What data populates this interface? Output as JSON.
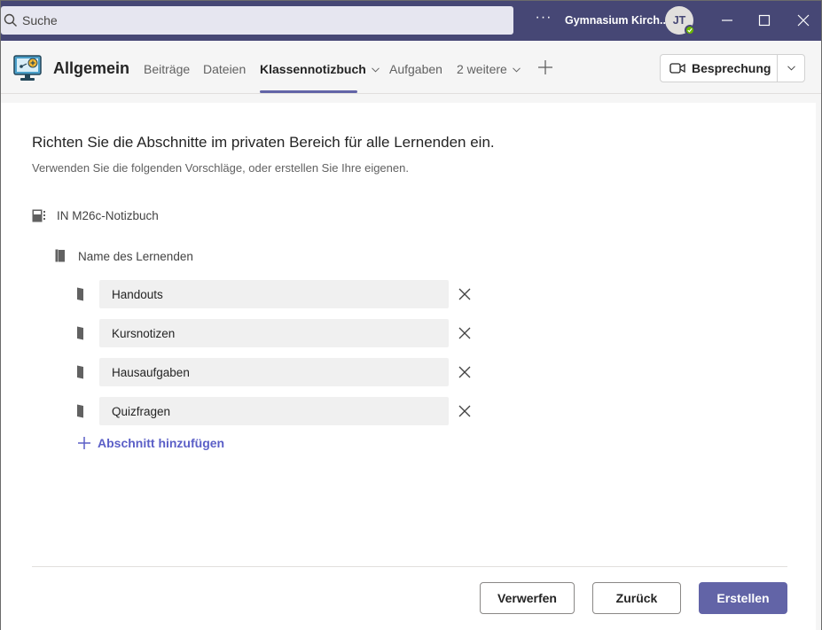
{
  "titlebar": {
    "search_placeholder": "Suche",
    "more_label": "···",
    "org_name": "Gymnasium Kirch...",
    "avatar_initials": "JT",
    "accent": "#464775"
  },
  "channel": {
    "title": "Allgemein",
    "tabs": [
      {
        "label": "Beiträge"
      },
      {
        "label": "Dateien"
      },
      {
        "label": "Klassennotizbuch"
      },
      {
        "label": "Aufgaben"
      },
      {
        "label": "2 weitere"
      }
    ],
    "active_tab": "Klassennotizbuch",
    "meeting_button": "Besprechung"
  },
  "dialog": {
    "headline": "Richten Sie die Abschnitte im privaten Bereich für alle Lernenden ein.",
    "subline": "Verwenden Sie die folgenden Vorschläge, oder erstellen Sie Ihre eigenen.",
    "notebook_name": "IN M26c-Notizbuch",
    "section_group": "Name des Lernenden",
    "sections": [
      {
        "name": "Handouts"
      },
      {
        "name": "Kursnotizen"
      },
      {
        "name": "Hausaufgaben"
      },
      {
        "name": "Quizfragen"
      }
    ],
    "add_section": "Abschnitt hinzufügen",
    "buttons": {
      "discard": "Verwerfen",
      "back": "Zurück",
      "create": "Erstellen"
    }
  }
}
